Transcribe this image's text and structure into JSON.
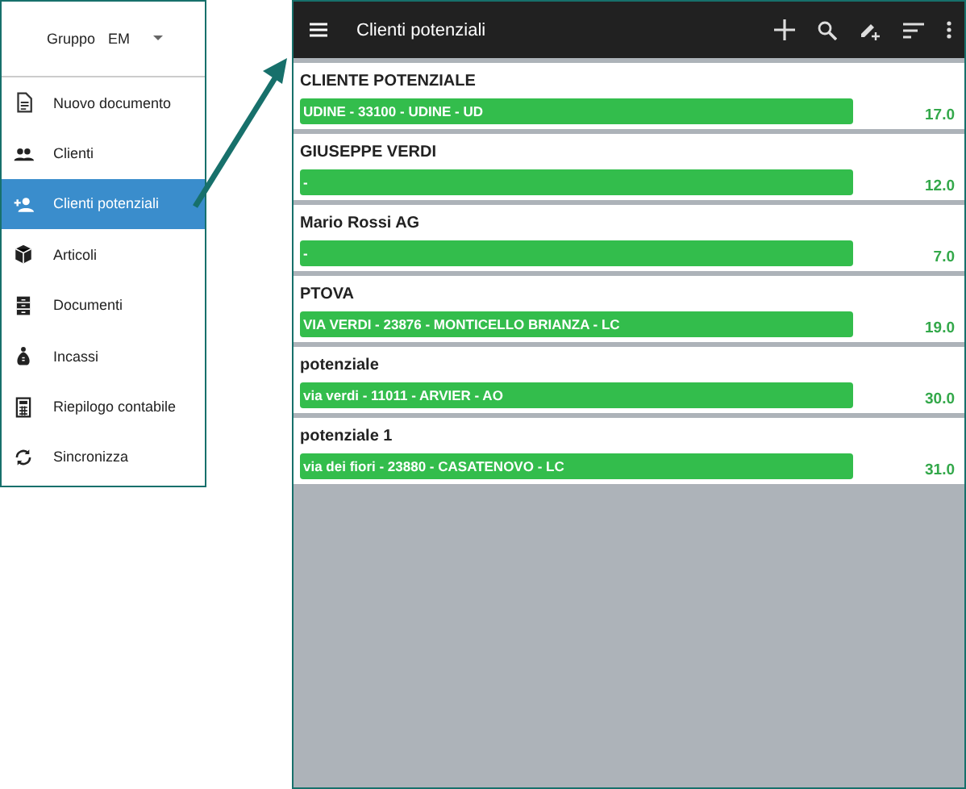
{
  "sidebar": {
    "group_label": "Gruppo",
    "group_value": "EM",
    "items": [
      {
        "label": "Nuovo documento",
        "selected": false
      },
      {
        "label": "Clienti",
        "selected": false
      },
      {
        "label": "Clienti potenziali",
        "selected": true
      },
      {
        "label": "Articoli",
        "selected": false
      },
      {
        "label": "Documenti",
        "selected": false
      },
      {
        "label": "Incassi",
        "selected": false
      },
      {
        "label": "Riepilogo contabile",
        "selected": false
      },
      {
        "label": "Sincronizza",
        "selected": false
      }
    ]
  },
  "toolbar": {
    "title": "Clienti potenziali"
  },
  "clients": [
    {
      "name": "CLIENTE POTENZIALE",
      "address": "UDINE - 33100 - UDINE - UD",
      "amount": "17.0"
    },
    {
      "name": "GIUSEPPE VERDI",
      "address": "-",
      "amount": "12.0"
    },
    {
      "name": "Mario Rossi AG",
      "address": "-",
      "amount": "7.0"
    },
    {
      "name": "PTOVA",
      "address": "VIA VERDI - 23876 - MONTICELLO BRIANZA - LC",
      "amount": "19.0"
    },
    {
      "name": "potenziale",
      "address": "via verdi - 11011 - ARVIER - AO",
      "amount": "30.0"
    },
    {
      "name": "potenziale 1",
      "address": "via dei fiori - 23880 - CASATENOVO - LC",
      "amount": "31.0"
    }
  ]
}
